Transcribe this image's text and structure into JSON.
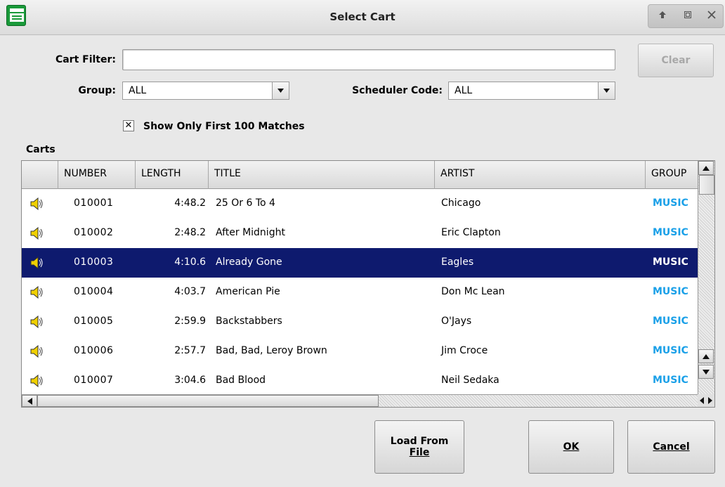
{
  "window": {
    "title": "Select Cart",
    "controls": [
      "up-arrow-icon",
      "maximize-icon",
      "close-icon"
    ]
  },
  "filter": {
    "cart_filter_label": "Cart Filter:",
    "cart_filter_value": "",
    "clear_label": "Clear",
    "group_label": "Group:",
    "group_value": "ALL",
    "scheduler_label": "Scheduler Code:",
    "scheduler_value": "ALL",
    "show_first_checked": true,
    "show_first_label": "Show Only First 100 Matches"
  },
  "carts": {
    "section_label": "Carts",
    "columns": [
      "",
      "NUMBER",
      "LENGTH",
      "TITLE",
      "ARTIST",
      "GROUP"
    ],
    "rows": [
      {
        "number": "010001",
        "length": "4:48.2",
        "title": "25 Or 6 To 4",
        "artist": "Chicago",
        "group": "MUSIC",
        "selected": false
      },
      {
        "number": "010002",
        "length": "2:48.2",
        "title": "After Midnight",
        "artist": "Eric Clapton",
        "group": "MUSIC",
        "selected": false
      },
      {
        "number": "010003",
        "length": "4:10.6",
        "title": "Already Gone",
        "artist": "Eagles",
        "group": "MUSIC",
        "selected": true
      },
      {
        "number": "010004",
        "length": "4:03.7",
        "title": "American Pie",
        "artist": "Don Mc Lean",
        "group": "MUSIC",
        "selected": false
      },
      {
        "number": "010005",
        "length": "2:59.9",
        "title": "Backstabbers",
        "artist": "O'Jays",
        "group": "MUSIC",
        "selected": false
      },
      {
        "number": "010006",
        "length": "2:57.7",
        "title": "Bad, Bad, Leroy Brown",
        "artist": "Jim Croce",
        "group": "MUSIC",
        "selected": false
      },
      {
        "number": "010007",
        "length": "3:04.6",
        "title": "Bad Blood",
        "artist": "Neil Sedaka",
        "group": "MUSIC",
        "selected": false
      }
    ]
  },
  "buttons": {
    "load_line1": "Load From",
    "load_line2": "File",
    "ok": "OK",
    "cancel": "Cancel"
  },
  "colors": {
    "selection": "#0e1a6e",
    "group_text": "#1aa0e8",
    "app_icon": "#1a9a3a"
  }
}
